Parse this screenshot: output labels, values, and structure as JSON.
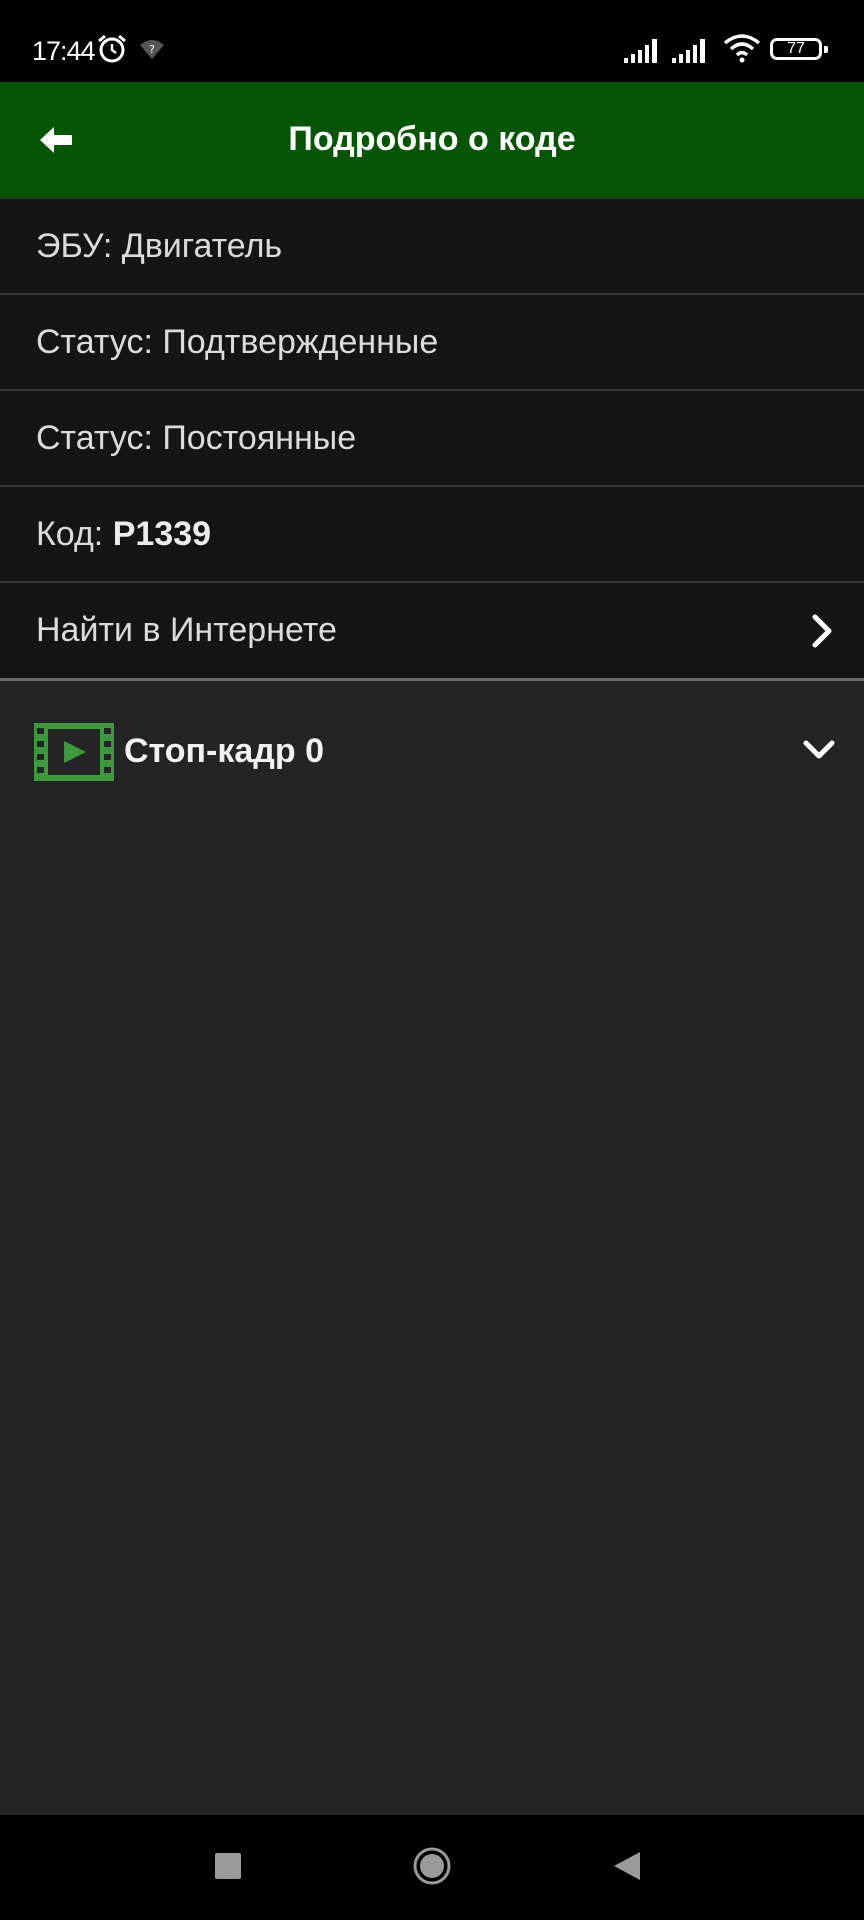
{
  "status_bar": {
    "time": "17:44",
    "battery": "77",
    "icons": [
      "alarm-icon",
      "wifi-unknown-icon",
      "signal-icon",
      "signal-icon",
      "wifi-icon",
      "battery-icon"
    ]
  },
  "header": {
    "title": "Подробно о коде",
    "back_icon": "arrow-back-icon",
    "color": "#055505"
  },
  "details": {
    "ecu": "ЭБУ: Двигатель",
    "status_confirmed": "Статус: Подтвержденные",
    "status_permanent": "Статус: Постоянные",
    "code_label": "Код: ",
    "code_value": "P1339",
    "search_online": "Найти в Интернете"
  },
  "freeze_frame": {
    "label": "Стоп-кадр 0",
    "icon": "film-icon",
    "icon_color": "#3f9a3f"
  },
  "nav_bar": {
    "buttons": [
      "recents-icon",
      "home-icon",
      "back-icon"
    ]
  }
}
